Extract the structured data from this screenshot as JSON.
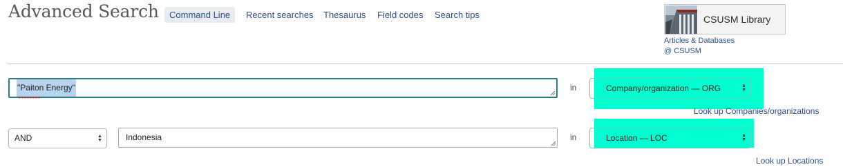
{
  "header": {
    "title": "Advanced Search",
    "nav": [
      {
        "label": "Command Line",
        "active": true
      },
      {
        "label": "Recent searches",
        "active": false
      },
      {
        "label": "Thesaurus",
        "active": false
      },
      {
        "label": "Field codes",
        "active": false
      },
      {
        "label": "Search tips",
        "active": false
      }
    ]
  },
  "library": {
    "name": "CSUSM Library",
    "subtitle_line1": "Articles & Databases",
    "subtitle_line2": "@ CSUSM"
  },
  "search_rows": [
    {
      "boolean": null,
      "query": "\"Paiton Energy\"",
      "query_selected": true,
      "in_label": "in",
      "field": "Company/organization — ORG",
      "lookup": "Look up Companies/organizations"
    },
    {
      "boolean": "AND",
      "query": "Indonesia",
      "query_selected": false,
      "in_label": "in",
      "field": "Location — LOC",
      "lookup": "Look up Locations"
    }
  ],
  "colors": {
    "field_highlight": "#00ffd0",
    "link": "#2b4f8f",
    "focus_border": "#2d7f86",
    "selection": "#b7d3ee"
  }
}
